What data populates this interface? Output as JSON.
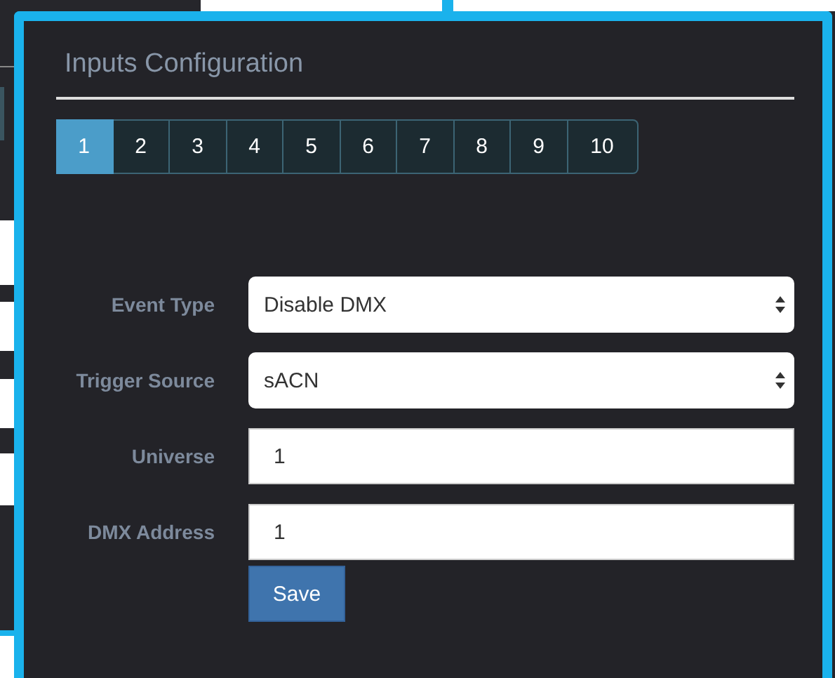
{
  "dialog": {
    "title": "Inputs Configuration",
    "pages": [
      {
        "label": "1",
        "selected": true
      },
      {
        "label": "2",
        "selected": false
      },
      {
        "label": "3",
        "selected": false
      },
      {
        "label": "4",
        "selected": false
      },
      {
        "label": "5",
        "selected": false
      },
      {
        "label": "6",
        "selected": false
      },
      {
        "label": "7",
        "selected": false
      },
      {
        "label": "8",
        "selected": false
      },
      {
        "label": "9",
        "selected": false
      },
      {
        "label": "10",
        "selected": false
      }
    ],
    "fields": [
      {
        "kind": "select",
        "label": "Event Type",
        "value": "Disable DMX"
      },
      {
        "kind": "select",
        "label": "Trigger Source",
        "value": "sACN"
      },
      {
        "kind": "text",
        "label": "Universe",
        "value": "1"
      },
      {
        "kind": "text",
        "label": "DMX Address",
        "value": "1"
      }
    ],
    "save_button": "Save"
  }
}
